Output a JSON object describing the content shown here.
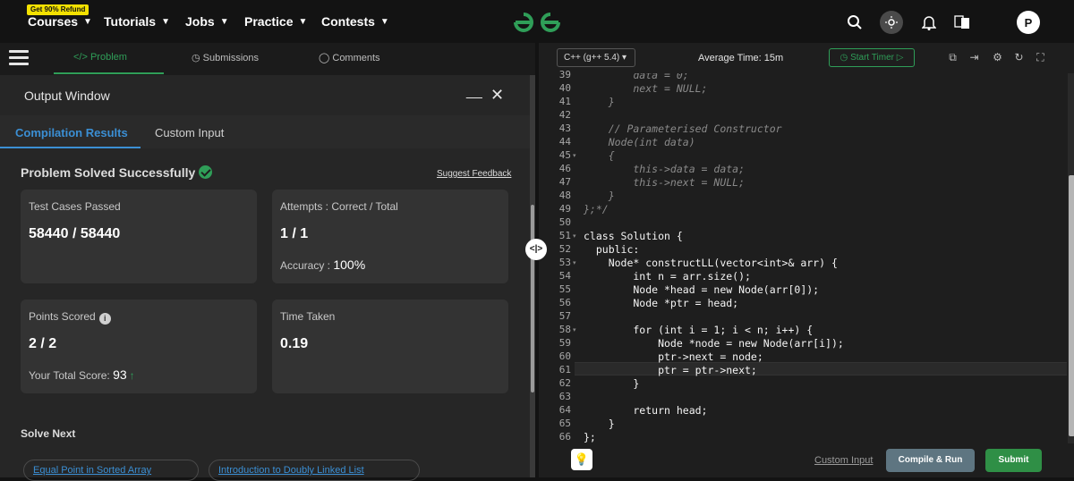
{
  "topnav": {
    "badge": "Get 90% Refund",
    "items": [
      {
        "label": "Courses"
      },
      {
        "label": "Tutorials"
      },
      {
        "label": "Jobs"
      },
      {
        "label": "Practice"
      },
      {
        "label": "Contests"
      }
    ],
    "avatar_initial": "P",
    "icons": [
      "search-icon",
      "theme-toggle-icon",
      "bell-icon",
      "translate-icon"
    ],
    "brand_color": "#2f9e58"
  },
  "problem_tabs": {
    "problem": "Problem",
    "submissions": "Submissions",
    "comments": "Comments"
  },
  "output": {
    "title": "Output Window",
    "tabs": {
      "compilation": "Compilation Results",
      "custom": "Custom Input"
    },
    "status": "Problem Solved Successfully",
    "feedback": "Suggest Feedback",
    "test_cases": {
      "title": "Test Cases Passed",
      "value": "58440 / 58440"
    },
    "attempts": {
      "title": "Attempts : Correct / Total",
      "value": "1 / 1",
      "accuracy_label": "Accuracy :",
      "accuracy_value": "100%"
    },
    "points": {
      "title": "Points Scored",
      "value": "2 / 2",
      "total_label": "Your Total Score:",
      "total_value": "93"
    },
    "time": {
      "title": "Time Taken",
      "value": "0.19"
    },
    "solve_next": "Solve Next",
    "next_items": [
      "Equal Point in Sorted Array",
      "Introduction to Doubly Linked List"
    ]
  },
  "editor": {
    "language": "C++ (g++ 5.4)",
    "avg_time": "Average Time: 15m",
    "start_timer": "Start Timer",
    "lines": [
      {
        "n": "39",
        "text": "        data = 0;",
        "cls": "cm"
      },
      {
        "n": "40",
        "text": "        next = NULL;",
        "cls": "cm"
      },
      {
        "n": "41",
        "text": "    }",
        "cls": "cm"
      },
      {
        "n": "42",
        "text": "",
        "cls": ""
      },
      {
        "n": "43",
        "text": "    // Parameterised Constructor",
        "cls": "cm"
      },
      {
        "n": "44",
        "text": "    Node(int data)",
        "cls": "cm"
      },
      {
        "n": "45",
        "text": "    {",
        "cls": "cm"
      },
      {
        "n": "46",
        "text": "        this->data = data;",
        "cls": "cm"
      },
      {
        "n": "47",
        "text": "        this->next = NULL;",
        "cls": "cm"
      },
      {
        "n": "48",
        "text": "    }",
        "cls": "cm"
      },
      {
        "n": "49",
        "text": "};*/",
        "cls": "cm"
      },
      {
        "n": "50",
        "text": "",
        "cls": ""
      },
      {
        "n": "51",
        "text": "class Solution {",
        "cls": ""
      },
      {
        "n": "52",
        "text": "  public:",
        "cls": ""
      },
      {
        "n": "53",
        "text": "    Node* constructLL(vector<int>& arr) {",
        "cls": ""
      },
      {
        "n": "54",
        "text": "        int n = arr.size();",
        "cls": ""
      },
      {
        "n": "55",
        "text": "        Node *head = new Node(arr[0]);",
        "cls": ""
      },
      {
        "n": "56",
        "text": "        Node *ptr = head;",
        "cls": ""
      },
      {
        "n": "57",
        "text": "",
        "cls": ""
      },
      {
        "n": "58",
        "text": "        for (int i = 1; i < n; i++) {",
        "cls": ""
      },
      {
        "n": "59",
        "text": "            Node *node = new Node(arr[i]);",
        "cls": ""
      },
      {
        "n": "60",
        "text": "            ptr->next = node;",
        "cls": ""
      },
      {
        "n": "61",
        "text": "            ptr = ptr->next;",
        "cls": ""
      },
      {
        "n": "62",
        "text": "        }",
        "cls": ""
      },
      {
        "n": "63",
        "text": "",
        "cls": ""
      },
      {
        "n": "64",
        "text": "        return head;",
        "cls": ""
      },
      {
        "n": "65",
        "text": "    }",
        "cls": ""
      },
      {
        "n": "66",
        "text": "};",
        "cls": ""
      }
    ],
    "fold_lines": [
      "45",
      "51",
      "53",
      "58"
    ],
    "custom_input": "Custom Input",
    "compile_run": "Compile & Run",
    "submit": "Submit"
  }
}
